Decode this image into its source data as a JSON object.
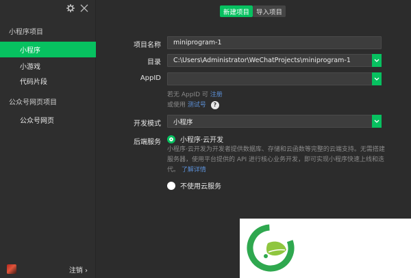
{
  "sidebar": {
    "section_miniprogram": "小程序项目",
    "items_mp": [
      {
        "label": "小程序"
      },
      {
        "label": "小游戏"
      },
      {
        "label": "代码片段"
      }
    ],
    "section_web": "公众号网页项目",
    "items_web": [
      {
        "label": "公众号网页"
      }
    ],
    "logout": "注销 ›"
  },
  "tabs": {
    "new_project": "新建项目",
    "import_project": "导入项目"
  },
  "form": {
    "name_label": "项目名称",
    "name_value": "miniprogram-1",
    "dir_label": "目录",
    "dir_value": "C:\\Users\\Administrator\\WeChatProjects\\miniprogram-1",
    "appid_label": "AppID",
    "appid_value": "",
    "appid_hint_prefix": "若无 AppID 可",
    "appid_hint_link": "注册",
    "test_hint_prefix": "或使用",
    "test_hint_link": "测试号",
    "help_glyph": "?",
    "mode_label": "开发模式",
    "mode_value": "小程序",
    "backend_label": "后端服务",
    "cloud_option": "小程序·云开发",
    "cloud_desc": "小程序·云开发为开发者提供数据库、存储和云函数等完整的云端支持。无需搭建服务器，使用平台提供的 API 进行核心业务开发，即可实现小程序快速上线和迭代。",
    "cloud_more": "了解详情",
    "no_cloud_option": "不使用云服务"
  },
  "colors": {
    "accent": "#07c160",
    "sidebar_bg": "#2e2e2e",
    "main_bg": "#2c2c2c",
    "field_bg": "#3d3d3d",
    "link": "#5b8fd6"
  },
  "icons": {
    "settings": "gear-icon",
    "close": "close-icon",
    "dropdown": "chevron-down-icon",
    "help": "help-icon",
    "watermark": "logo-icon"
  }
}
